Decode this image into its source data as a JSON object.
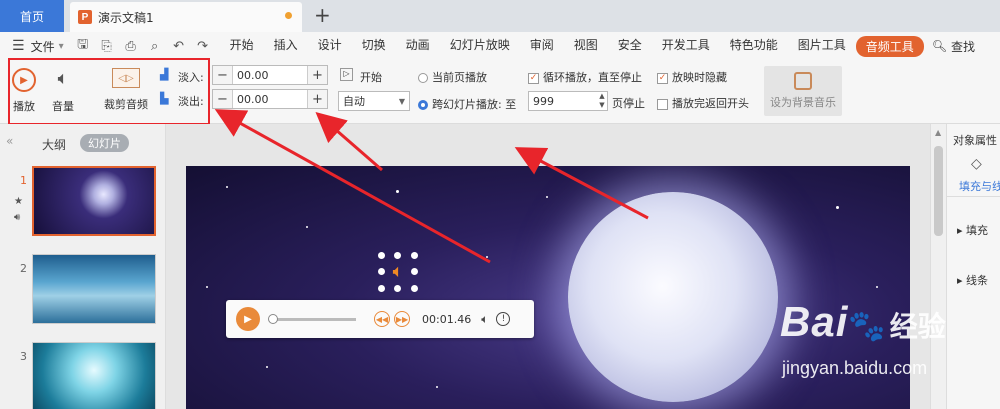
{
  "tabs": {
    "home": "首页",
    "doc": "演示文稿1",
    "add": "+"
  },
  "menu": {
    "file": "文件",
    "items": [
      "开始",
      "插入",
      "设计",
      "切换",
      "动画",
      "幻灯片放映",
      "审阅",
      "视图",
      "安全",
      "开发工具",
      "特色功能",
      "图片工具",
      "音频工具"
    ],
    "search": "查找"
  },
  "ribbon": {
    "play": "播放",
    "volume": "音量",
    "trim": "裁剪音频",
    "fade_in": "淡入:",
    "fade_out": "淡出:",
    "fade_in_value": "00.00",
    "fade_out_value": "00.00",
    "start_label": "开始",
    "start_value": "自动",
    "current_page": "当前页播放",
    "cross_slides": "跨幻灯片播放: 至",
    "stop_page_value": "999",
    "stop_page_suffix": "页停止",
    "loop": "循环播放，直至停止",
    "hide": "放映时隐藏",
    "rewind": "播放完返回开头",
    "set_bg": "设为背景音乐"
  },
  "left_panel": {
    "outline": "大纲",
    "slides": "幻灯片",
    "numbers": [
      "1",
      "2",
      "3"
    ]
  },
  "player": {
    "time": "00:01.46"
  },
  "right_panel": {
    "title": "对象属性",
    "tab": "填充与线",
    "fill": "填充",
    "line": "线条"
  },
  "watermark": {
    "brand": "Bai",
    "cn": "经验",
    "url": "jingyan.baidu.com"
  },
  "colors": {
    "accent": "#e2632f",
    "home_tab": "#3b78d8",
    "annotation_red": "#e8252b"
  }
}
